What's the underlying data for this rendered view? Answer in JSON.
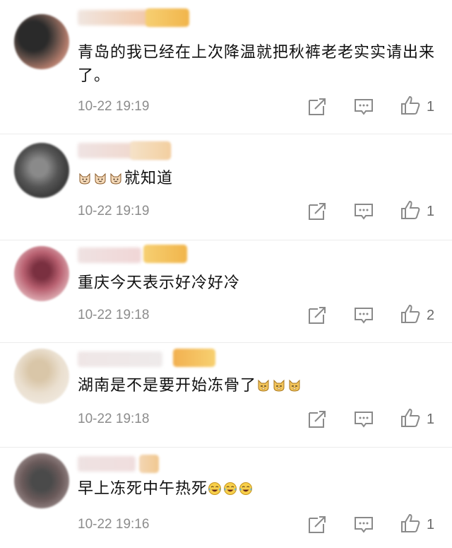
{
  "comments": [
    {
      "text": "青岛的我已经在上次降温就把秋裤老老实实请出来了。",
      "emojis": [],
      "emoji_icon": "",
      "time": "10-22 19:19",
      "likes": "1"
    },
    {
      "text": "就知道",
      "emojis": [
        "cat-face",
        "cat-face",
        "cat-face"
      ],
      "emoji_icon": "cat-face-icon",
      "time": "10-22 19:19",
      "likes": "1"
    },
    {
      "text": "重庆今天表示好冷好冷",
      "emojis": [],
      "emoji_icon": "",
      "time": "10-22 19:18",
      "likes": "2"
    },
    {
      "text": "湖南是不是要开始冻骨了",
      "emojis": [
        "doge",
        "doge",
        "doge"
      ],
      "emoji_icon": "doge-icon",
      "time": "10-22 19:18",
      "likes": "1"
    },
    {
      "text": "早上冻死中午热死",
      "emojis": [
        "laugh-cry",
        "laugh-cry",
        "laugh-cry"
      ],
      "emoji_icon": "laugh-cry-icon",
      "time": "10-22 19:16",
      "likes": "1"
    }
  ],
  "colors": {
    "text": "#111111",
    "meta": "#8c8c8c",
    "icon": "#8a8a8a",
    "badge": "#f3c35e"
  },
  "icons": {
    "share": "share-icon",
    "comment": "comment-icon",
    "like": "thumbs-up-icon"
  }
}
